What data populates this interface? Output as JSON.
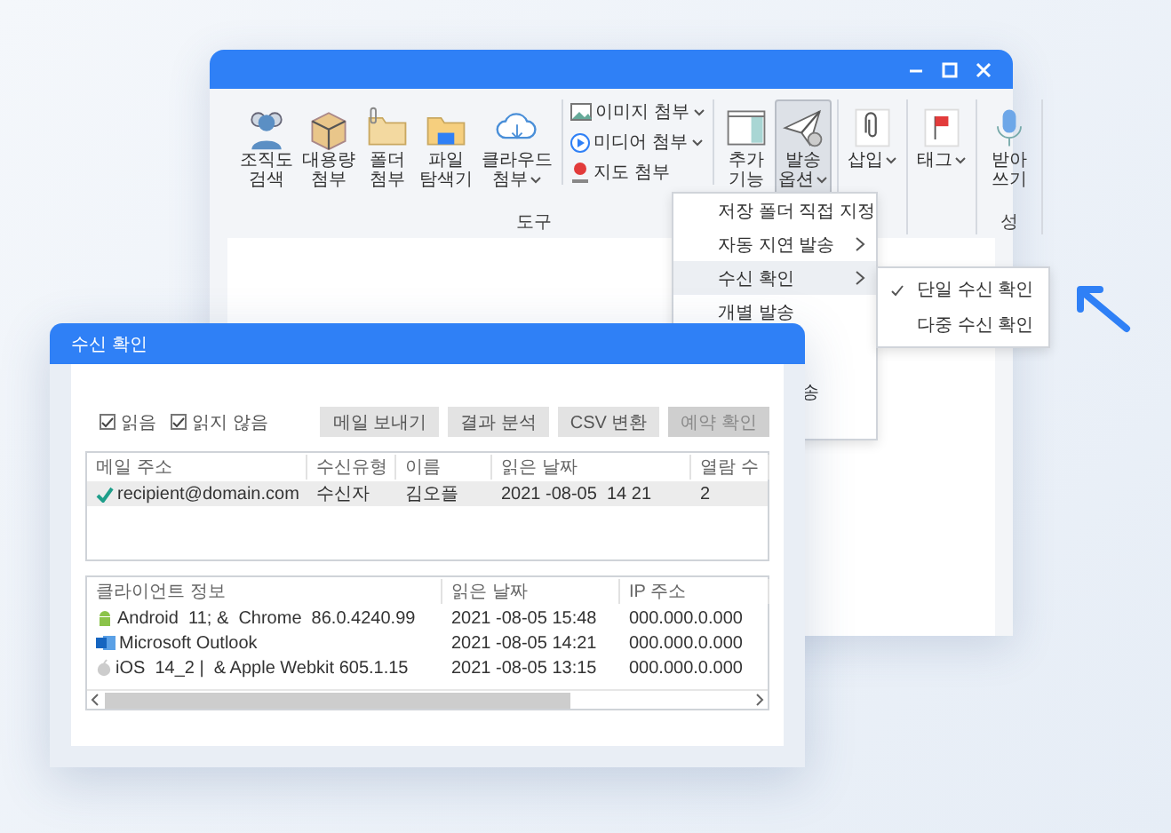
{
  "main_window": {
    "ribbon": {
      "groups": [
        {
          "label": "도구",
          "items": [
            {
              "kind": "people",
              "label_lines": [
                "조직도",
                "검색"
              ],
              "dropdown": false,
              "selected": false
            },
            {
              "kind": "box",
              "label_lines": [
                "대용량",
                "첨부"
              ],
              "dropdown": false,
              "selected": false
            },
            {
              "kind": "folder",
              "label_lines": [
                "폴더",
                "첨부"
              ],
              "dropdown": false,
              "selected": false
            },
            {
              "kind": "explorer",
              "label_lines": [
                "파일",
                "탐색기"
              ],
              "dropdown": false,
              "selected": false
            },
            {
              "kind": "cloud",
              "label_lines": [
                "클라우드",
                "첨부"
              ],
              "dropdown": true,
              "selected": false
            }
          ],
          "small_items": [
            {
              "kind": "image",
              "label": "이미지 첨부",
              "dropdown": true
            },
            {
              "kind": "media",
              "label": "미디어 첨부",
              "dropdown": true
            },
            {
              "kind": "map",
              "label": "지도 첨부",
              "dropdown": false
            }
          ],
          "trailing": [
            {
              "kind": "addon",
              "label_lines": [
                "추가",
                "기능"
              ],
              "dropdown": false,
              "selected": false
            },
            {
              "kind": "plane",
              "label_lines": [
                "발송",
                "옵션"
              ],
              "dropdown": true,
              "selected": true
            }
          ]
        },
        {
          "items": [
            {
              "kind": "clip",
              "label_lines": [
                "삽입"
              ],
              "dropdown": true,
              "selected": false
            }
          ]
        },
        {
          "items": [
            {
              "kind": "flag",
              "label_lines": [
                "태그"
              ],
              "dropdown": true,
              "selected": false
            }
          ]
        },
        {
          "label": "성",
          "items": [
            {
              "kind": "mic",
              "label_lines": [
                "받아",
                "쓰기"
              ],
              "dropdown": false,
              "selected": false
            }
          ]
        }
      ]
    }
  },
  "send_menu": {
    "items": [
      {
        "label": "저장 폴더 직접 지정",
        "submenu": false,
        "selected": false
      },
      {
        "label": "자동 지연 발송",
        "submenu": true,
        "selected": false
      },
      {
        "label": "수신 확인",
        "submenu": true,
        "selected": true
      },
      {
        "label": "개별 발송",
        "submenu": false,
        "selected": false
      },
      {
        "label": "송",
        "submenu": false,
        "selected": false
      }
    ],
    "submenu": [
      {
        "label": "단일 수신 확인",
        "checked": true
      },
      {
        "label": "다중 수신 확인",
        "checked": false
      }
    ]
  },
  "dialog": {
    "title": "수신 확인",
    "filters": [
      {
        "label": "읽음",
        "checked": true
      },
      {
        "label": "읽지 않음",
        "checked": true
      }
    ],
    "buttons": [
      {
        "label": "메일 보내기",
        "disabled": false
      },
      {
        "label": "결과 분석",
        "disabled": false
      },
      {
        "label": "CSV 변환",
        "disabled": false
      },
      {
        "label": "예약 확인",
        "disabled": true
      }
    ],
    "recipients": {
      "columns": [
        "메일 주소",
        "수신유형",
        "이름",
        "읽은 날짜",
        "열람 수"
      ],
      "rows": [
        {
          "read": true,
          "selected": true,
          "cells": [
            "recipient@domain.com",
            "수신자",
            "김오플",
            "2021 -08-05  14 21",
            "2"
          ]
        }
      ]
    },
    "clients": {
      "columns": [
        "클라이언트 정보",
        "읽은 날짜",
        "IP 주소"
      ],
      "rows": [
        {
          "kind": "android",
          "cells": [
            "Android  11; &  Chrome  86.0.4240.99",
            "2021 -08-05 15:48",
            "000.000.0.000"
          ]
        },
        {
          "kind": "outlook",
          "cells": [
            "Microsoft Outlook",
            "2021 -08-05 14:21",
            "000.000.0.000"
          ]
        },
        {
          "kind": "apple",
          "cells": [
            "iOS  14_2 |  & Apple Webkit 605.1.15",
            "2021 -08-05 13:15",
            "000.000.0.000"
          ]
        }
      ]
    }
  }
}
